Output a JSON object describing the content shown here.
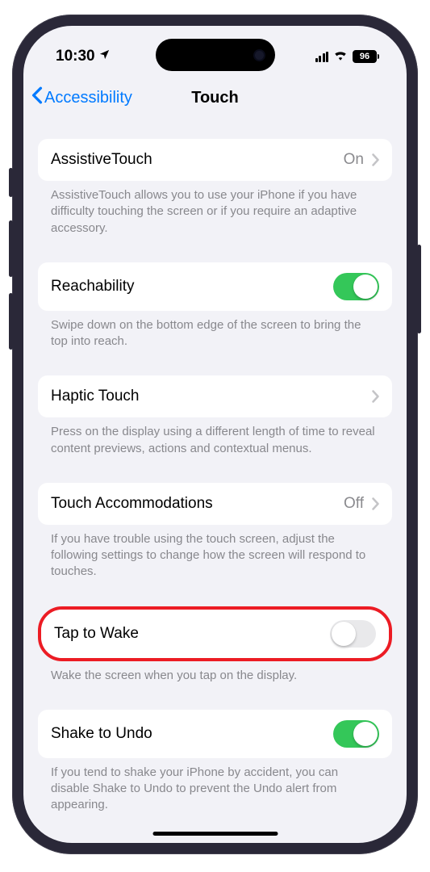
{
  "statusbar": {
    "time": "10:30",
    "battery": "96"
  },
  "nav": {
    "back_label": "Accessibility",
    "title": "Touch"
  },
  "rows": {
    "assistive": {
      "label": "AssistiveTouch",
      "value": "On",
      "footer": "AssistiveTouch allows you to use your iPhone if you have difficulty touching the screen or if you require an adaptive accessory."
    },
    "reachability": {
      "label": "Reachability",
      "footer": "Swipe down on the bottom edge of the screen to bring the top into reach."
    },
    "haptic": {
      "label": "Haptic Touch",
      "footer": "Press on the display using a different length of time to reveal content previews, actions and contextual menus."
    },
    "accommodations": {
      "label": "Touch Accommodations",
      "value": "Off",
      "footer": "If you have trouble using the touch screen, adjust the following settings to change how the screen will respond to touches."
    },
    "tapwake": {
      "label": "Tap to Wake",
      "footer": "Wake the screen when you tap on the display."
    },
    "shake": {
      "label": "Shake to Undo",
      "footer": "If you tend to shake your iPhone by accident, you can disable Shake to Undo to prevent the Undo alert from appearing."
    }
  }
}
